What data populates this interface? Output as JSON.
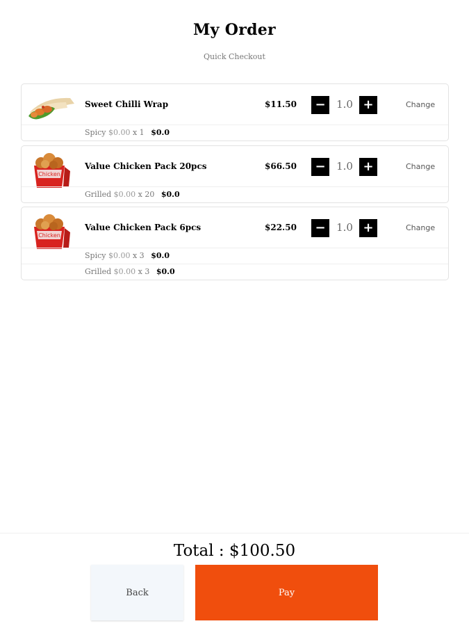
{
  "header": {
    "title": "My Order",
    "subtitle": "Quick Checkout"
  },
  "order": {
    "items": [
      {
        "name": "Sweet Chilli Wrap",
        "price": "$11.50",
        "quantity": "1.0",
        "change_label": "Change",
        "image_icon": "wrap-image",
        "options": [
          {
            "name": "Spicy",
            "unit_price": "$0.00",
            "multiplier": "x 1",
            "total": "$0.0"
          }
        ]
      },
      {
        "name": "Value Chicken Pack 20pcs",
        "price": "$66.50",
        "quantity": "1.0",
        "change_label": "Change",
        "image_icon": "chicken-bucket-image",
        "options": [
          {
            "name": "Grilled",
            "unit_price": "$0.00",
            "multiplier": "x 20",
            "total": "$0.0"
          }
        ]
      },
      {
        "name": "Value Chicken Pack 6pcs",
        "price": "$22.50",
        "quantity": "1.0",
        "change_label": "Change",
        "image_icon": "chicken-bucket-image",
        "options": [
          {
            "name": "Spicy",
            "unit_price": "$0.00",
            "multiplier": "x 3",
            "total": "$0.0"
          },
          {
            "name": "Grilled",
            "unit_price": "$0.00",
            "multiplier": "x 3",
            "total": "$0.0"
          }
        ]
      }
    ],
    "quantity_controls": {
      "minus_symbol": "−",
      "plus_symbol": "+"
    }
  },
  "footer": {
    "total_text": "Total : $100.50",
    "back_label": "Back",
    "pay_label": "Pay"
  },
  "colors": {
    "pay_button": "#f04e0d",
    "back_button": "#f3f7fb",
    "qty_button": "#000000"
  }
}
